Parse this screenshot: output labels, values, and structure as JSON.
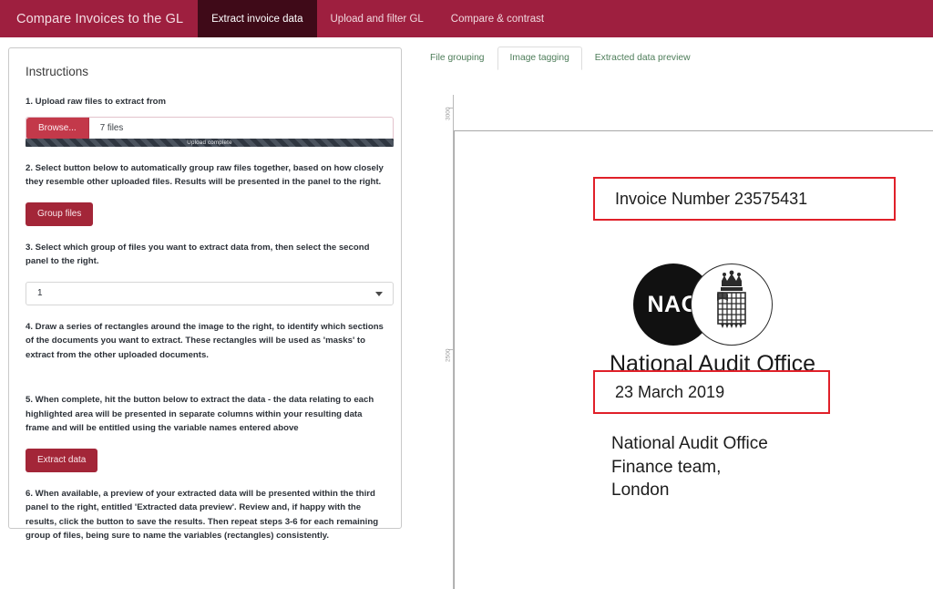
{
  "navbar": {
    "brand": "Compare Invoices to the GL",
    "tabs": [
      {
        "label": "Extract invoice data",
        "active": true
      },
      {
        "label": "Upload and filter GL",
        "active": false
      },
      {
        "label": "Compare & contrast",
        "active": false
      }
    ],
    "background_color": "#9e1f3f",
    "active_tab_color": "#3f0a18"
  },
  "instructions": {
    "title": "Instructions",
    "step1": "1. Upload raw files to extract from",
    "browse_label": "Browse...",
    "file_status": "7 files",
    "progress_label": "Upload complete",
    "step2": "2. Select button below to automatically group raw files together, based on how closely they resemble other uploaded files. Results will be presented in the panel to the right.",
    "group_files_label": "Group files",
    "step3": "3. Select which group of files you want to extract data from, then select the second panel to the right.",
    "group_select_value": "1",
    "group_select_options": [
      "1"
    ],
    "step4": "4. Draw a series of rectangles around the image to the right, to identify which sections of the documents you want to extract. These rectangles will be used as 'masks' to extract from the other uploaded documents.",
    "step5": "5. When complete, hit the button below to extract the data - the data relating to each highlighted area will be presented in separate columns within your resulting data frame and will be entitled using the variable names entered above",
    "extract_data_label": "Extract data",
    "step6": "6. When available, a preview of your extracted data will be presented within the third panel to the right, entitled 'Extracted data preview'. Review and, if happy with the results, click the button to save the results. Then repeat steps 3-6 for each remaining group of files, being sure to name the variables (rectangles) consistently.",
    "button_color": "#a32638"
  },
  "right_panel": {
    "tabs": [
      {
        "label": "File grouping",
        "active": false
      },
      {
        "label": "Image tagging",
        "active": true
      },
      {
        "label": "Extracted data preview",
        "active": false
      }
    ],
    "tab_text_color": "#4e7d5a"
  },
  "document_preview": {
    "axis": {
      "tick_labels": [
        "3000",
        "2500"
      ]
    },
    "mask_color": "#e02029",
    "masks": [
      {
        "name": "invoice-number",
        "text": "Invoice Number 23575431"
      },
      {
        "name": "invoice-date",
        "text": "23 March 2019"
      }
    ],
    "logo": {
      "mark_text": "NAO",
      "name": "National Audit Office"
    },
    "address": "National Audit Office\nFinance team,\nLondon"
  }
}
